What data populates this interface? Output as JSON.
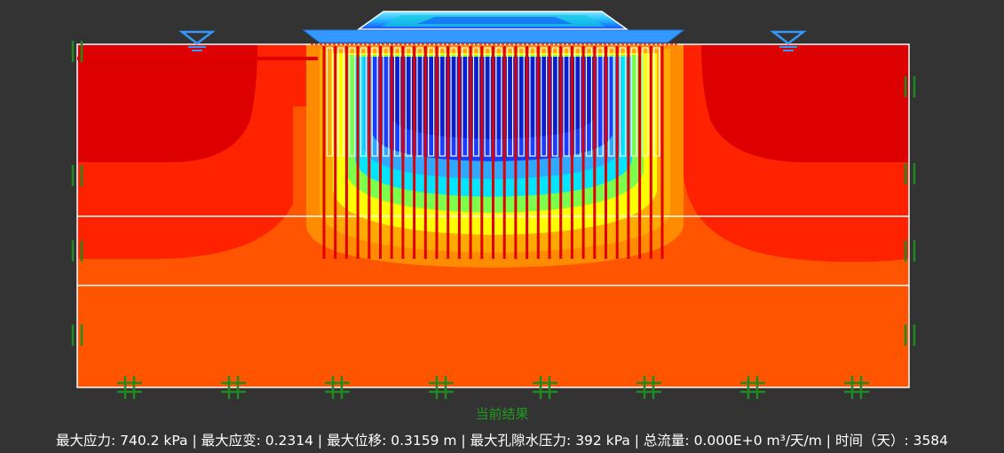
{
  "caption": "当前结果",
  "status": {
    "text": "最大应力: 740.2 kPa | 最大应变: 0.2314 | 最大位移: 0.3159 m | 最大孔隙水压力: 392 kPa | 总流量: 0.000E+0 m³/天/m | 时间（天）: 3584"
  },
  "colors": {
    "background": "#333333",
    "contour_max": "#dd0000",
    "contour_high": "#ff2200",
    "contour_mid": "#ff5500",
    "contour_orange": "#ff9900",
    "contour_yellow": "#ffff00",
    "contour_cyan": "#00e5ff",
    "contour_blue": "#1a3cff",
    "boundary_green": "#1f8a1f",
    "water_table_blue": "#3399ff",
    "outline": "#ffffff"
  },
  "icons": {
    "water_table_left": "water-table-triangle",
    "water_table_right": "water-table-triangle",
    "roller_support": "roller-support-double-line",
    "fixed_support": "fixed-support-hash"
  }
}
